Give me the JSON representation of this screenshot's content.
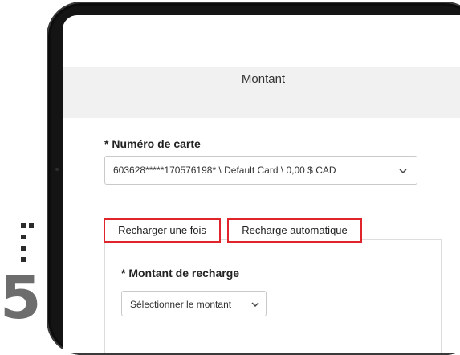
{
  "step": {
    "number": "5"
  },
  "page": {
    "title": "Montant"
  },
  "card": {
    "label": "* Numéro de carte",
    "selected_value": "603628*****170576198* \\ Default Card \\ 0,00 $ CAD"
  },
  "tabs": [
    {
      "label": "Recharger une fois"
    },
    {
      "label": "Recharge automatique"
    }
  ],
  "recharge": {
    "label": "* Montant de recharge",
    "selected_value": "Sélectionner le montant"
  },
  "colors": {
    "highlight": "#e0242c",
    "header_band": "#f1f1f1",
    "step_number": "#6d6d6d"
  },
  "icons": {
    "select_arrow": "chevron-down-icon",
    "step_indicator": "vertical-dots"
  }
}
